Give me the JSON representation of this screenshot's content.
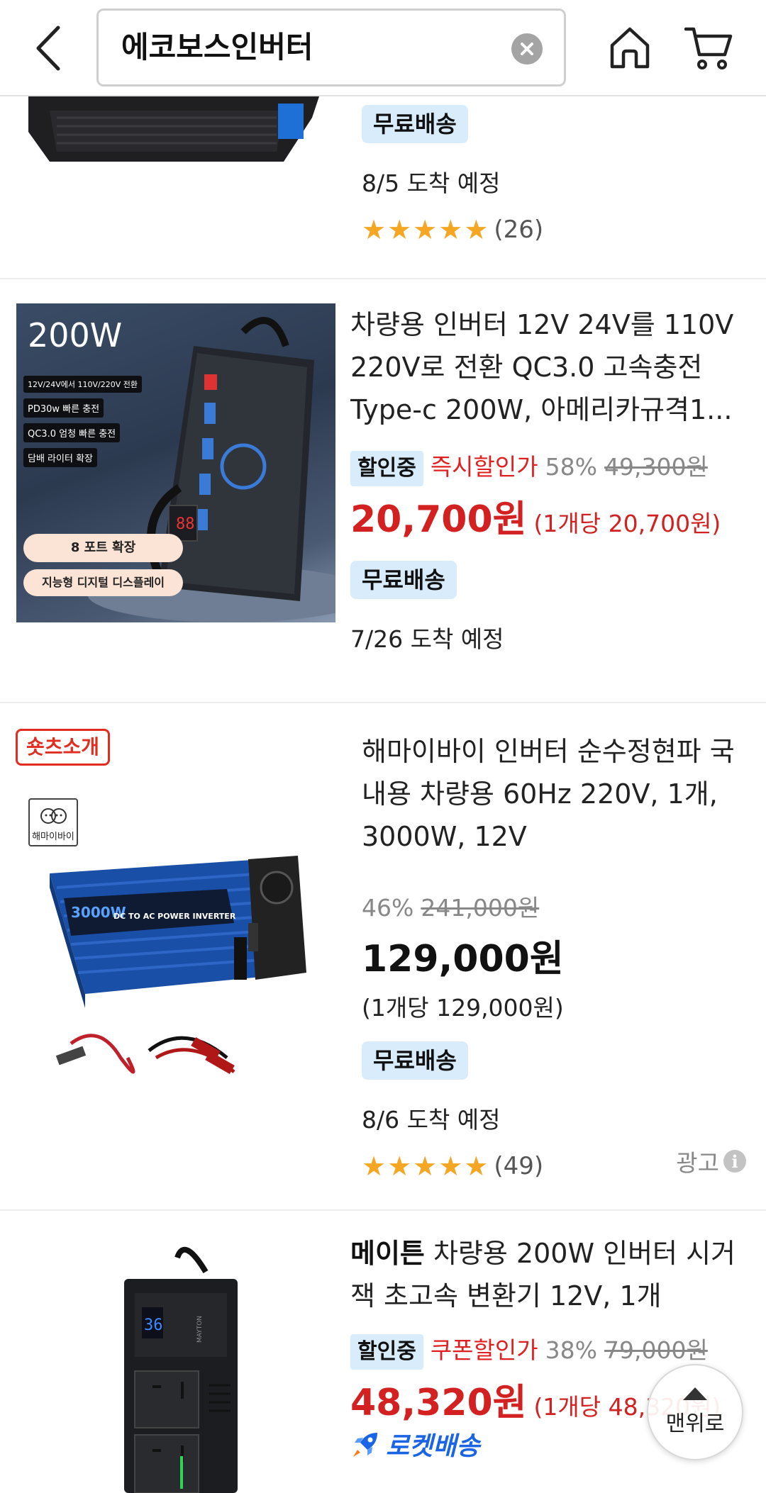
{
  "header": {
    "search_query": "에코보스인버터"
  },
  "products": [
    {
      "free_shipping": "무료배송",
      "arrival": "8/5 도착 예정",
      "rating_stars": 5,
      "review_count": "(26)"
    },
    {
      "title": "차량용 인버터 12V 24V를 110V 220V로 전환 QC3.0 고속충전 Type-c 200W, 아메리카규격1...",
      "thumb": {
        "wattage": "200W",
        "lines": [
          "12V/24V에서 110V/220V 전환",
          "PD30w 빠른 충전",
          "QC3.0 엄청 빠른 충전",
          "담배 라이터 확장"
        ],
        "pill1": "8 포트 확장",
        "pill2": "지능형 디지털 디스플레이"
      },
      "sale_badge": "할인중",
      "sale_type": "즉시할인가",
      "discount": "58%",
      "original_price": "49,300원",
      "price": "20,700원",
      "unit_price": "(1개당 20,700원)",
      "free_shipping": "무료배송",
      "arrival": "7/26 도착 예정"
    },
    {
      "shorts_tag": "숏츠소개",
      "brand_logo": "해마이바이",
      "thumb_text": "3000W",
      "thumb_subtext": "DC TO AC POWER INVERTER",
      "title": "해마이바이 인버터 순수정현파 국내용 차량용 60Hz 220V, 1개, 3000W, 12V",
      "discount": "46%",
      "original_price": "241,000원",
      "price": "129,000원",
      "unit_price": "(1개당 129,000원)",
      "free_shipping": "무료배송",
      "arrival": "8/6 도착 예정",
      "rating_stars": 5,
      "review_count": "(49)",
      "ad_label": "광고"
    },
    {
      "brand": "메이튼",
      "title_rest": " 차량용 200W 인버터 시거잭 초고속 변환기 12V, 1개",
      "sale_badge": "할인중",
      "sale_type": "쿠폰할인가",
      "discount": "38%",
      "original_price": "79,000원",
      "price": "48,320원",
      "unit_price": "(1개당 48,320원)",
      "delivery": "로켓배송",
      "thumb_brand": "MAYTON",
      "thumb_display": "36"
    }
  ],
  "scroll_top_label": "맨위로",
  "colors": {
    "sale_red": "#d32020",
    "badge_blue_bg": "#d8ecfb",
    "star": "#f5a623",
    "rocket_blue": "#1a64e6"
  }
}
